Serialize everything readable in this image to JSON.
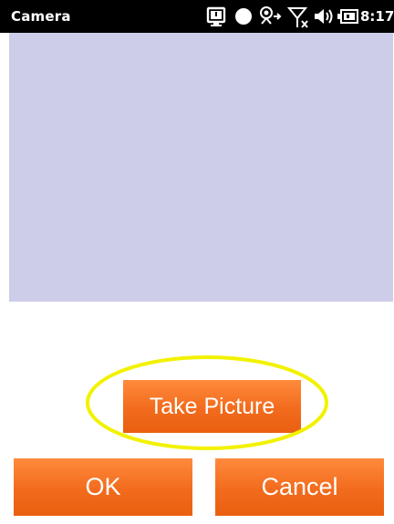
{
  "status_bar": {
    "title": "Camera",
    "time": "8:17",
    "icons": [
      "notification-icon",
      "recording-dot-icon",
      "connectivity-icon",
      "no-signal-icon",
      "volume-icon",
      "battery-icon"
    ]
  },
  "viewfinder": {
    "color": "#cdcdea"
  },
  "buttons": {
    "take_picture": "Take Picture",
    "ok": "OK",
    "cancel": "Cancel"
  },
  "colors": {
    "button_orange": "#f26b1d",
    "highlight_yellow": "#f2f200",
    "status_bar_bg": "#000000"
  }
}
